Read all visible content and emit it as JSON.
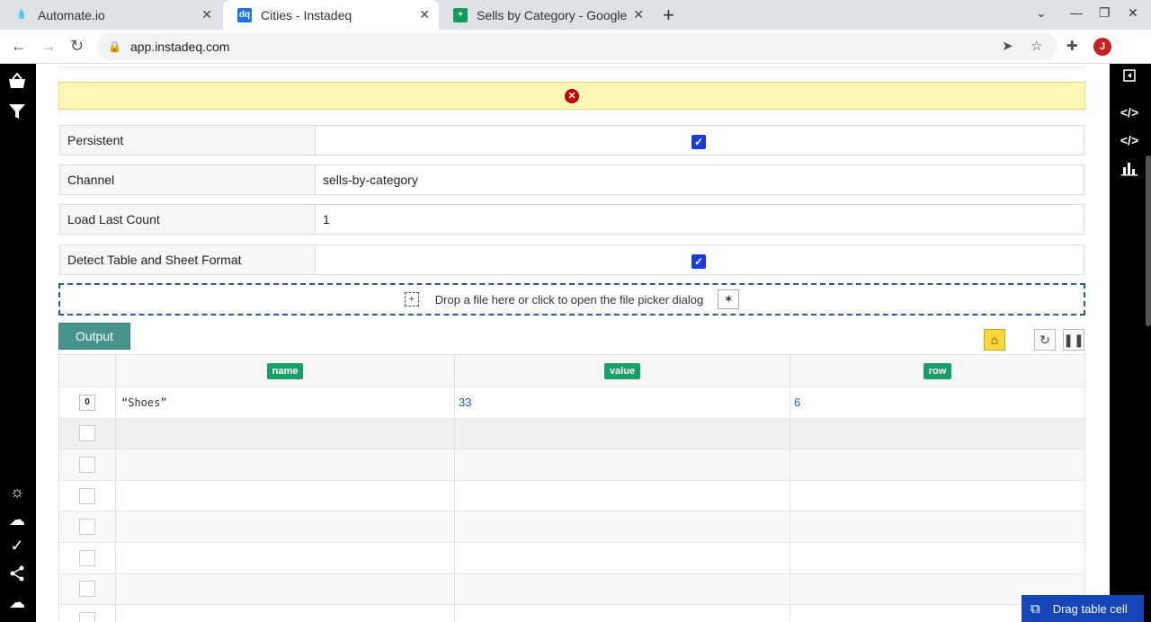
{
  "browser": {
    "tabs": [
      {
        "title": "Automate.io",
        "favicon": "drop"
      },
      {
        "title": "Cities - Instadeq",
        "favicon": "dq"
      },
      {
        "title": "Sells by Category - Google",
        "favicon": "sheets"
      }
    ],
    "url": "app.instadeq.com",
    "avatar_letter": "J"
  },
  "alert": {
    "icon": "error-icon"
  },
  "fields": {
    "persistent_label": "Persistent",
    "persistent_checked": true,
    "channel_label": "Channel",
    "channel_value": "sells-by-category",
    "load_last_count_label": "Load Last Count",
    "load_last_count_value": "1",
    "detect_label": "Detect Table and Sheet Format",
    "detect_checked": true
  },
  "dropzone": {
    "text": "Drop a file here or click to open the file picker dialog"
  },
  "output": {
    "label": "Output"
  },
  "table": {
    "columns": [
      "name",
      "value",
      "row"
    ],
    "rows": [
      {
        "index": "0",
        "name": "“Shoes”",
        "value": "33",
        "row": "6"
      }
    ]
  },
  "drag_cell": {
    "label": "Drag table cell"
  },
  "colors": {
    "accent": "#45958c",
    "header_pill": "#19a068",
    "checkbox": "#1a3bdb",
    "alert_bg": "#fff8b4",
    "drag_bg": "#1546b8"
  }
}
